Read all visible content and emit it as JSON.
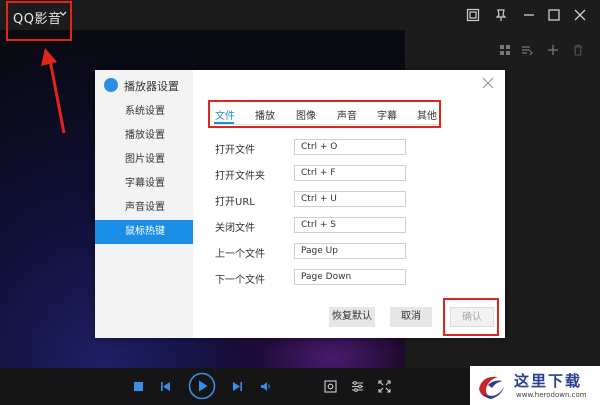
{
  "app": {
    "title": "QQ影音",
    "window_icons": [
      "screenshot-icon",
      "pin-icon",
      "minimize-icon",
      "maximize-icon",
      "close-icon"
    ],
    "playlist_icons": [
      "grid-view-icon",
      "sort-icon",
      "add-icon",
      "delete-icon"
    ],
    "controls": [
      "stop-icon",
      "previous-icon",
      "play-icon",
      "next-icon",
      "volume-icon",
      "screenshot-tool-icon",
      "settings-sliders-icon",
      "fullscreen-icon"
    ]
  },
  "dialog": {
    "title": "播放器设置",
    "sidebar": [
      {
        "label": "系统设置",
        "active": false
      },
      {
        "label": "播放设置",
        "active": false
      },
      {
        "label": "图片设置",
        "active": false
      },
      {
        "label": "字幕设置",
        "active": false
      },
      {
        "label": "声音设置",
        "active": false
      },
      {
        "label": "鼠标热键",
        "active": true
      }
    ],
    "tabs": [
      {
        "label": "文件",
        "active": true
      },
      {
        "label": "播放",
        "active": false
      },
      {
        "label": "图像",
        "active": false
      },
      {
        "label": "声音",
        "active": false
      },
      {
        "label": "字幕",
        "active": false
      },
      {
        "label": "其他",
        "active": false
      }
    ],
    "hotkeys": [
      {
        "label": "打开文件",
        "value": "Ctrl + O"
      },
      {
        "label": "打开文件夹",
        "value": "Ctrl + F"
      },
      {
        "label": "打开URL",
        "value": "Ctrl + U"
      },
      {
        "label": "关闭文件",
        "value": "Ctrl + S"
      },
      {
        "label": "上一个文件",
        "value": "Page Up"
      },
      {
        "label": "下一个文件",
        "value": "Page Down"
      }
    ],
    "buttons": {
      "reset": "恢复默认",
      "cancel": "取消",
      "ok": "确认"
    }
  },
  "watermark": {
    "text": "这里下载",
    "url": "www.herodown.com"
  },
  "colors": {
    "accent": "#1a8ee6",
    "callout": "#e0261b"
  }
}
